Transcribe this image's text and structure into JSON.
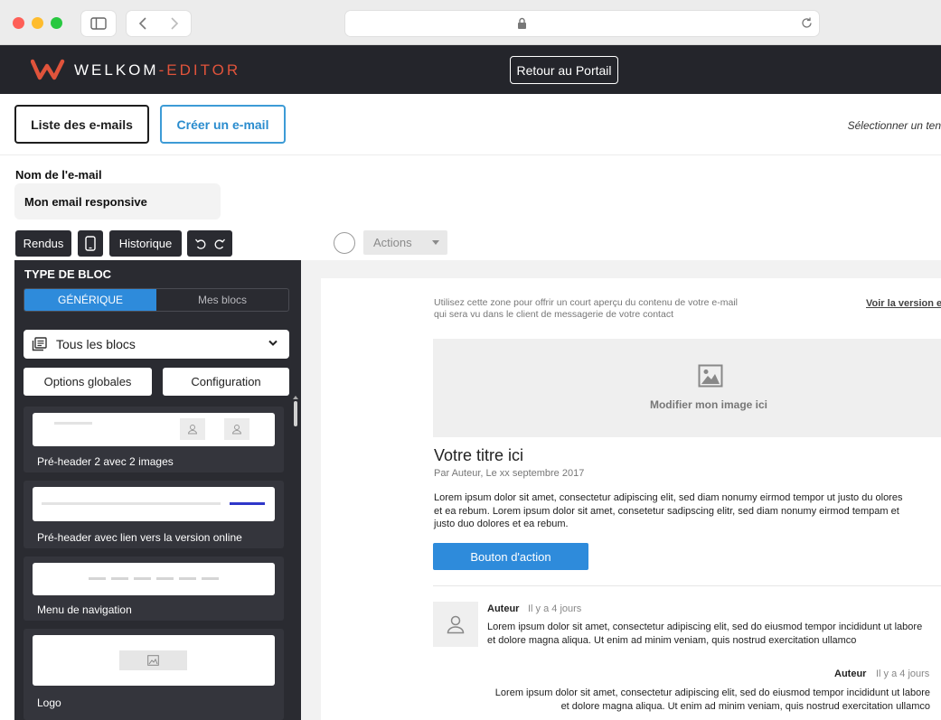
{
  "app": {
    "brand_main": "WELKOM",
    "brand_accent": "-EDITOR",
    "portal_button": "Retour au Portail"
  },
  "tabs": {
    "list": "Liste des e-mails",
    "create": "Créer un e-mail",
    "template_hint": "Sélectionner un ten"
  },
  "email_name": {
    "label": "Nom de l'e-mail",
    "value": "Mon email responsive"
  },
  "toolbar": {
    "rendus": "Rendus",
    "historique": "Historique",
    "actions": "Actions"
  },
  "panel": {
    "title": "TYPE DE BLOC",
    "seg_generic": "GÉNÉRIQUE",
    "seg_mine": "Mes blocs",
    "select_value": "Tous les blocs",
    "global_options": "Options globales",
    "configuration": "Configuration",
    "blocks": [
      {
        "label": "Pré-header 2 avec 2 images"
      },
      {
        "label": "Pré-header avec lien vers la version online"
      },
      {
        "label": "Menu de navigation"
      },
      {
        "label": "Logo"
      }
    ]
  },
  "preview": {
    "preheader_line1": "Utilisez cette zone pour offrir un court aperçu du contenu de votre e-mail",
    "preheader_line2": "qui sera vu dans le client de messagerie de votre contact",
    "online_link": "Voir la version e",
    "image_text": "Modifier mon image ici",
    "title": "Votre titre ici",
    "byline": "Par Auteur, Le xx septembre 2017",
    "body": "Lorem ipsum dolor sit amet, consectetur adipiscing elit, sed diam nonumy eirmod tempor ut justo du olores et ea rebum. Lorem ipsum dolor sit amet, consetetur sadipscing elitr, sed diam nonumy eirmod tempam et justo duo dolores et ea rebum.",
    "cta": "Bouton d'action",
    "comment1": {
      "author": "Auteur",
      "time": "Il y a 4 jours",
      "body": "Lorem ipsum dolor sit amet, consectetur adipiscing elit, sed do eiusmod tempor incididunt ut labore et dolore magna aliqua. Ut enim ad minim veniam, quis nostrud exercitation ullamco"
    },
    "comment2": {
      "author": "Auteur",
      "time": "Il y a 4 jours",
      "body": "Lorem ipsum dolor sit amet, consectetur adipiscing elit, sed do eiusmod tempor incididunt ut labore et dolore magna aliqua. Ut enim ad minim veniam, quis nostrud exercitation ullamco"
    }
  },
  "colors": {
    "header_bg": "#24252b",
    "accent_orange": "#e0533b",
    "primary_blue": "#2e8bdb"
  }
}
